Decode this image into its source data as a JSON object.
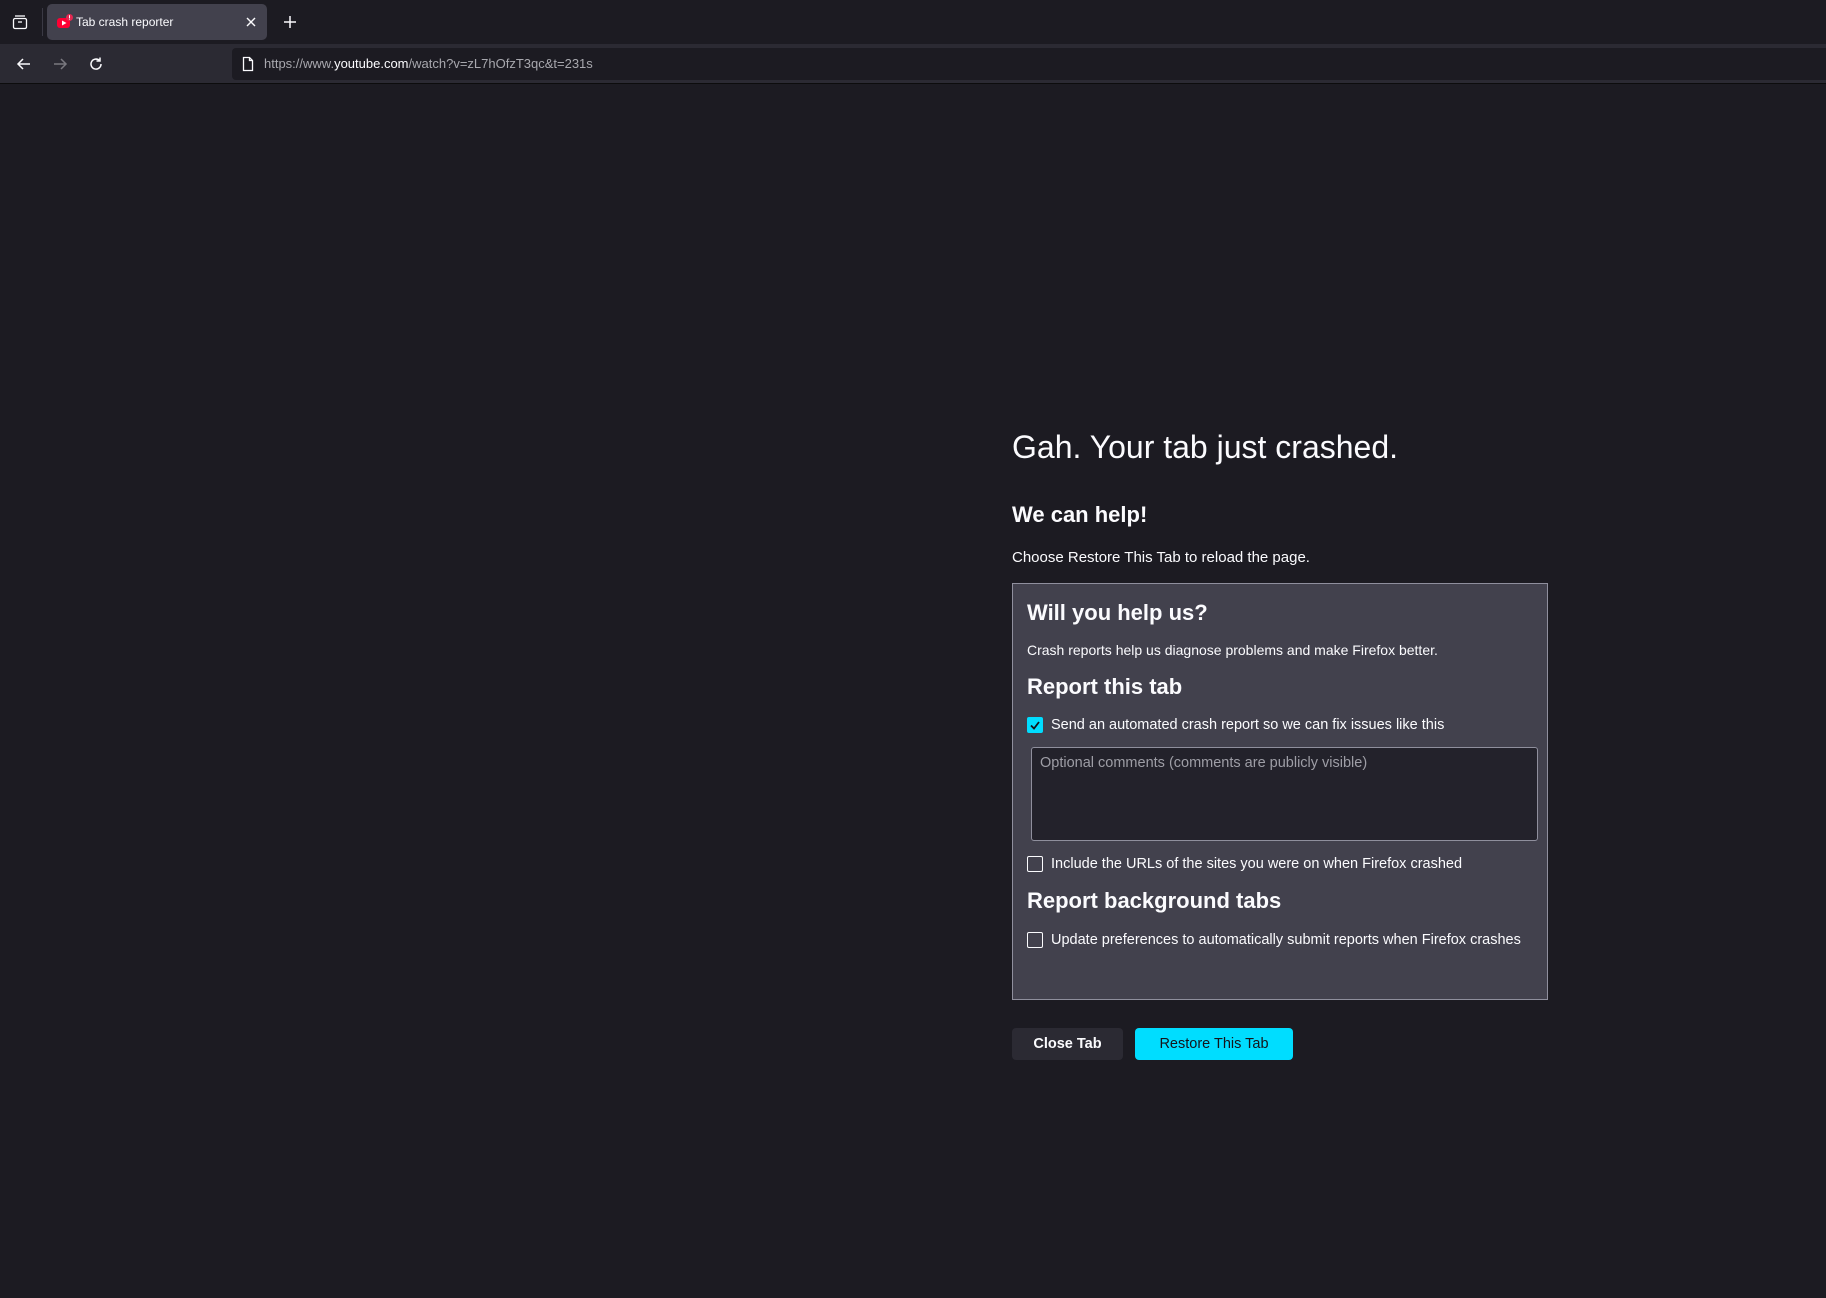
{
  "browser": {
    "tab": {
      "title": "Tab crash reporter",
      "favicon": "youtube-crashed-icon"
    },
    "url": {
      "prefix": "https://www.",
      "host": "youtube.com",
      "path": "/watch?v=zL7hOfzT3qc&t=231s"
    }
  },
  "page": {
    "title": "Gah. Your tab just crashed.",
    "help_title": "We can help!",
    "help_desc": "Choose Restore This Tab to reload the page.",
    "report_box": {
      "heading": "Will you help us?",
      "description": "Crash reports help us diagnose problems and make Firefox better.",
      "report_tab_heading": "Report this tab",
      "send_report_label": "Send an automated crash report so we can fix issues like this",
      "send_report_checked": true,
      "comments_placeholder": "Optional comments (comments are publicly visible)",
      "include_urls_label": "Include the URLs of the sites you were on when Firefox crashed",
      "include_urls_checked": false,
      "background_heading": "Report background tabs",
      "auto_submit_label": "Update preferences to automatically submit reports when Firefox crashes",
      "auto_submit_checked": false
    },
    "buttons": {
      "close": "Close Tab",
      "restore": "Restore This Tab"
    }
  },
  "colors": {
    "accent": "#00ddff",
    "background": "#1c1b22",
    "box": "#42414d"
  }
}
